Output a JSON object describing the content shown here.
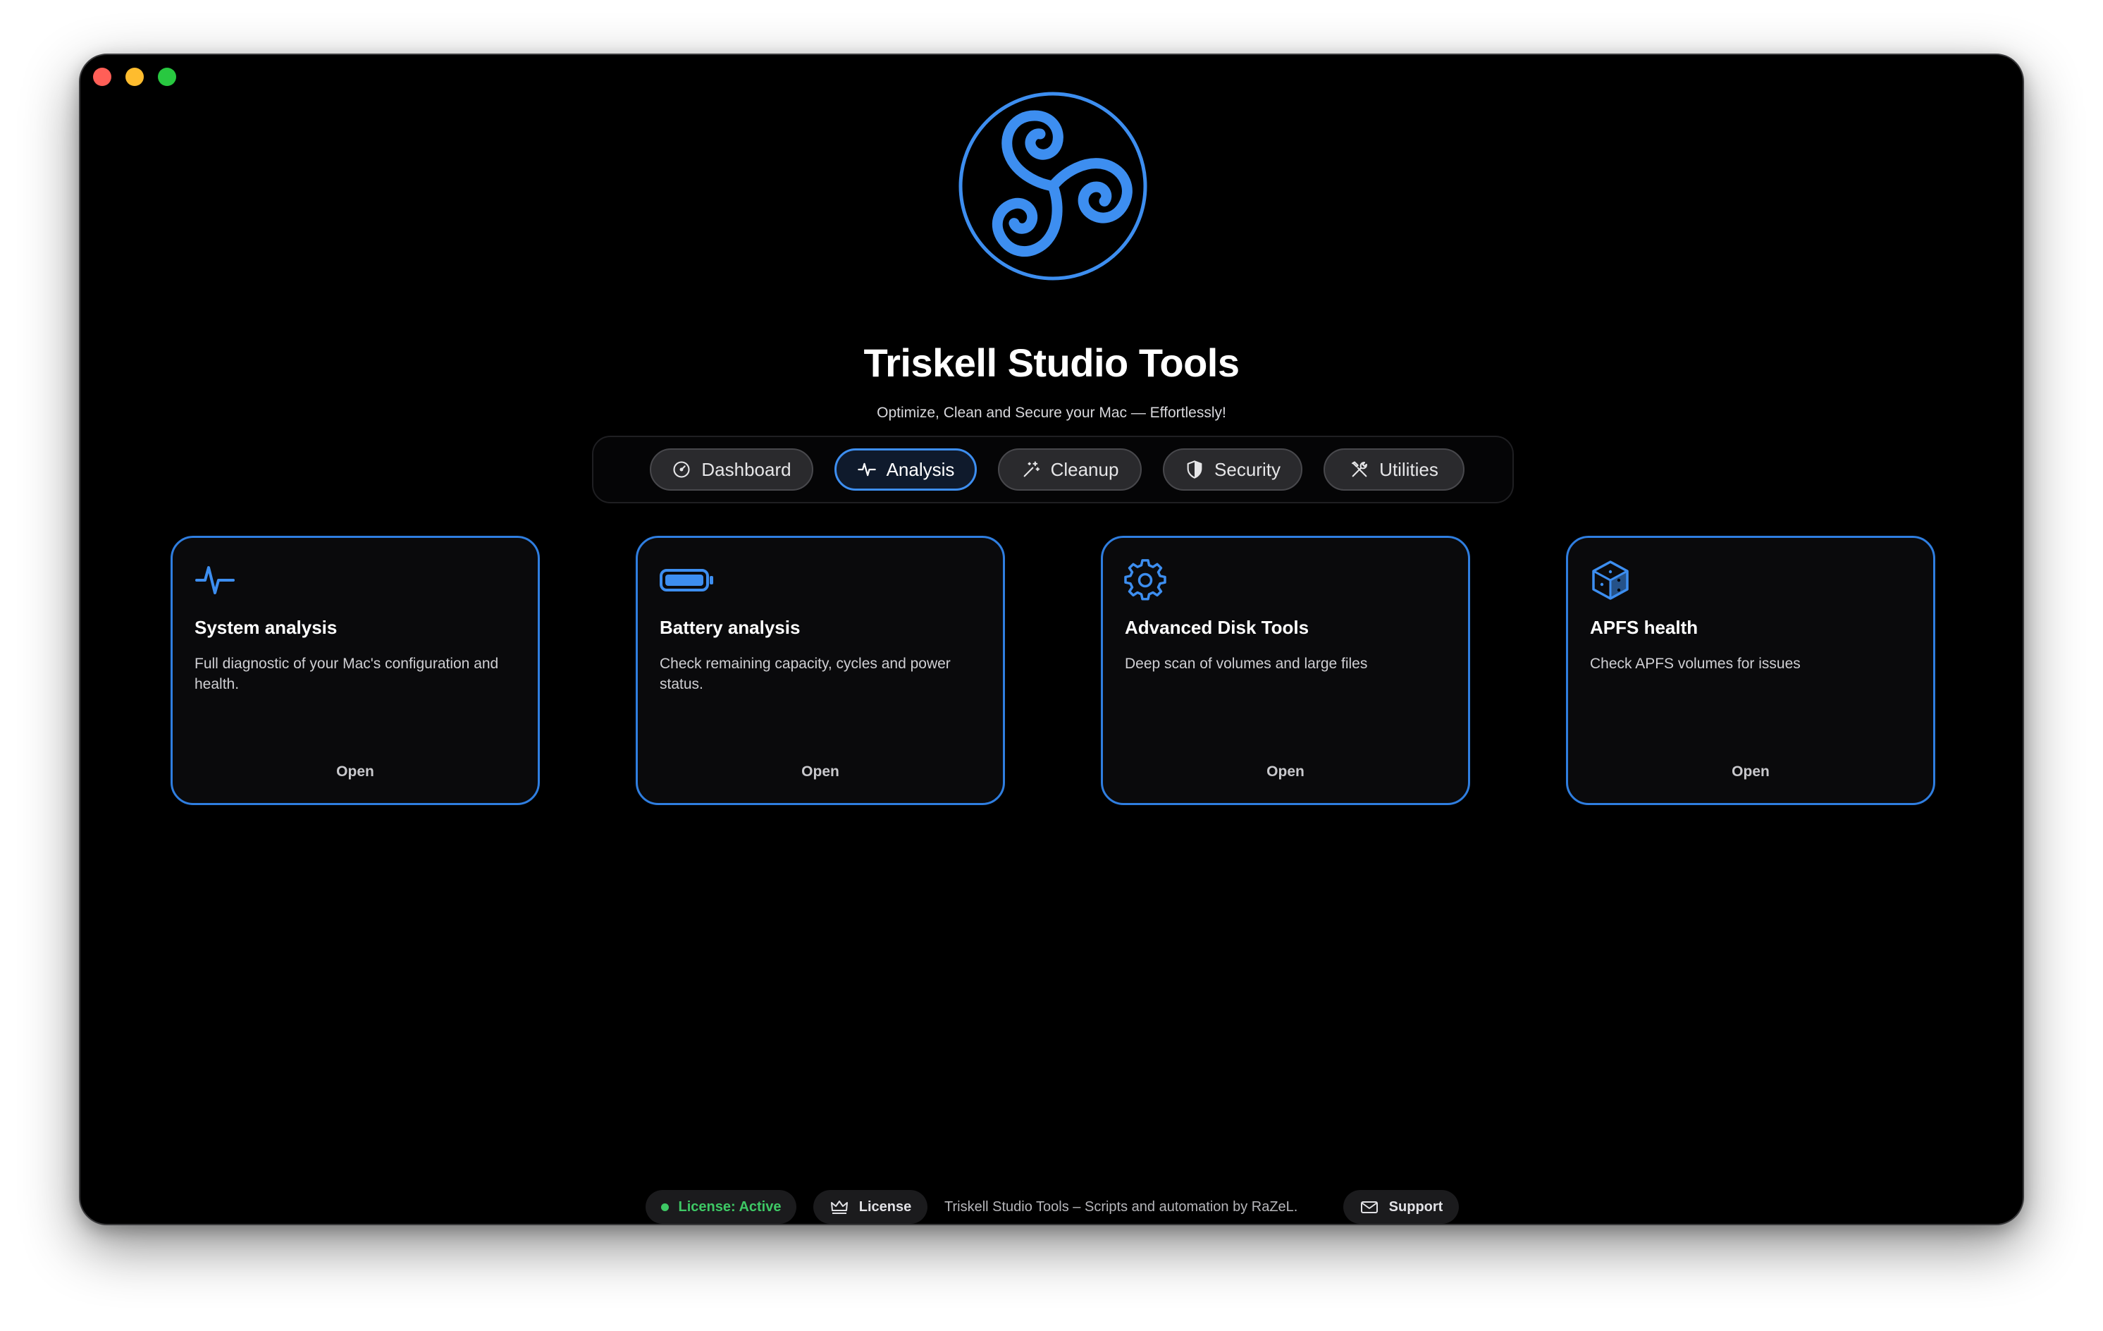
{
  "app": {
    "title": "Triskell Studio Tools",
    "subtitle": "Optimize, Clean and Secure your Mac — Effortlessly!"
  },
  "tabs": [
    {
      "label": "Dashboard",
      "icon": "gauge-icon",
      "active": false
    },
    {
      "label": "Analysis",
      "icon": "waveform-icon",
      "active": true
    },
    {
      "label": "Cleanup",
      "icon": "sparkles-icon",
      "active": false
    },
    {
      "label": "Security",
      "icon": "shield-icon",
      "active": false
    },
    {
      "label": "Utilities",
      "icon": "tools-icon",
      "active": false
    }
  ],
  "cards": [
    {
      "title": "System analysis",
      "description": "Full diagnostic of your Mac's configuration and health.",
      "action": "Open",
      "icon": "waveform-icon"
    },
    {
      "title": "Battery analysis",
      "description": "Check remaining capacity, cycles and power status.",
      "action": "Open",
      "icon": "battery-icon"
    },
    {
      "title": "Advanced Disk Tools",
      "description": "Deep scan of volumes and large files",
      "action": "Open",
      "icon": "gear-icon"
    },
    {
      "title": "APFS health",
      "description": "Check APFS volumes for issues",
      "action": "Open",
      "icon": "cube-icon"
    }
  ],
  "footer": {
    "license_status": "License: Active",
    "license_button": "License",
    "credits": "Triskell Studio Tools – Scripts and automation by RaZeL.",
    "support_button": "Support"
  },
  "colors": {
    "accent": "#3d8ef0",
    "background": "#000000",
    "status_active": "#3ec865"
  }
}
